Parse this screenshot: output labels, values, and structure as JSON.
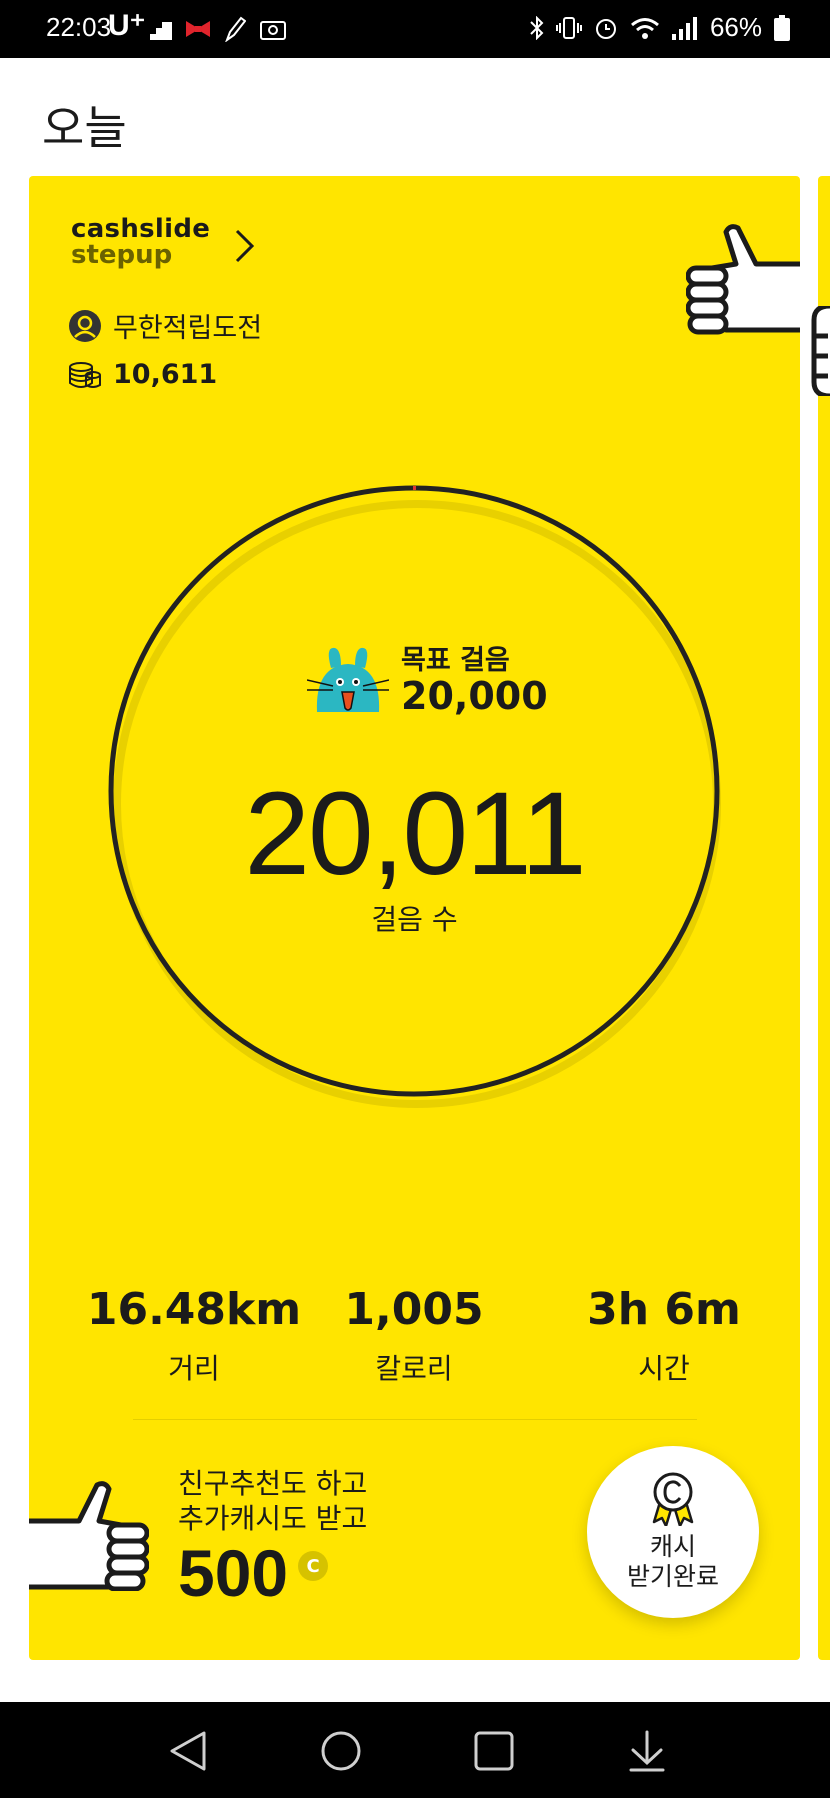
{
  "status_bar": {
    "time": "22:03",
    "carrier": "U⁺",
    "battery_percent": "66%",
    "icons_left": [
      "stairs-icon",
      "ribbon-icon",
      "pen-icon",
      "photo-icon"
    ],
    "icons_right": [
      "bluetooth-icon",
      "vibrate-icon",
      "alarm-icon",
      "wifi-icon",
      "signal-icon",
      "battery-icon"
    ]
  },
  "header": {
    "title": "오늘"
  },
  "card": {
    "background": "#ffe500",
    "brand_line1": "cashslide",
    "brand_line2": "stepup",
    "user_name": "무한적립도전",
    "coin_balance": "10,611",
    "goal_label": "목표 걸음",
    "goal_value": "20,000",
    "steps_value": "20,011",
    "steps_label": "걸음 수",
    "stats": [
      {
        "value": "16.48km",
        "label": "거리"
      },
      {
        "value": "1,005",
        "label": "칼로리"
      },
      {
        "value": "3h 6m",
        "label": "시간"
      }
    ],
    "promo_line1": "친구추천도 하고",
    "promo_line2": "추가캐시도 받고",
    "promo_amount": "500",
    "promo_coin_symbol": "C",
    "cash_button_line1": "캐시",
    "cash_button_line2": "받기완료"
  },
  "nav_bar": {
    "buttons": [
      "back-icon",
      "home-icon",
      "recents-icon",
      "notifications-pulldown-icon"
    ]
  }
}
